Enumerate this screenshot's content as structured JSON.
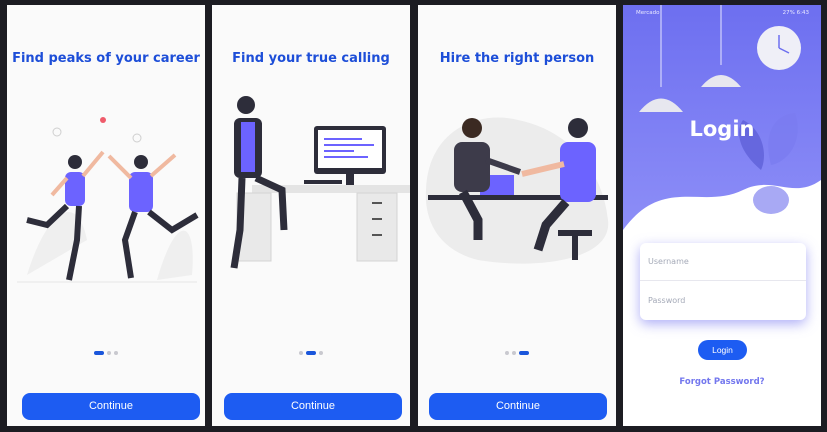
{
  "colors": {
    "accent": "#1d5cf2",
    "title": "#1d4ed8",
    "purple": "#6c63ff",
    "login_gradient_top": "#6d6ff0",
    "login_gradient_bottom": "#8d8ef7"
  },
  "onboarding": [
    {
      "title": "Find peaks of your career",
      "button_label": "Continue",
      "active_dot": 0
    },
    {
      "title": "Find your true calling",
      "button_label": "Continue",
      "active_dot": 1
    },
    {
      "title": "Hire the right person",
      "button_label": "Continue",
      "active_dot": 2
    }
  ],
  "login": {
    "status_left": "Mercado",
    "status_right": "27% 6:43",
    "title": "Login",
    "username_placeholder": "Username",
    "password_placeholder": "Password",
    "button_label": "Login",
    "forgot_label": "Forgot Password?"
  }
}
